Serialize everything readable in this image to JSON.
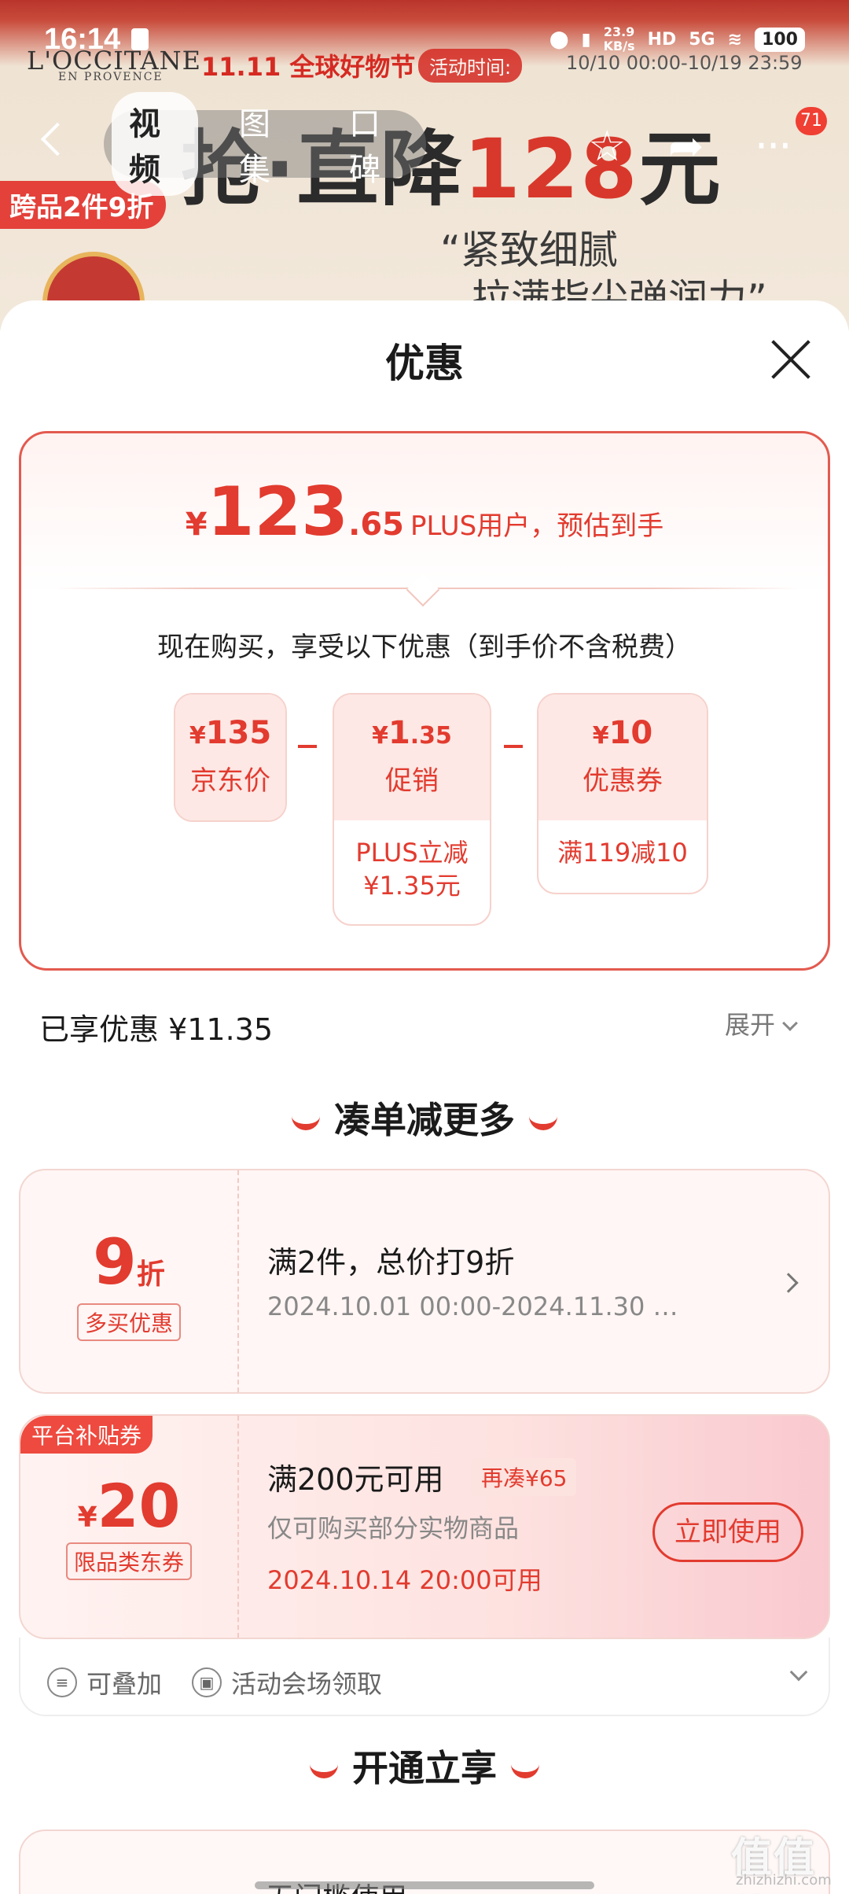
{
  "status_bar": {
    "time": "16:14",
    "net_speed_top": "23.9",
    "net_speed_bottom": "KB/s",
    "hd": "HD",
    "signal": "5G",
    "battery": "100"
  },
  "background": {
    "brand_logo": "L'OCCITANE",
    "brand_sub": "EN PROVENCE",
    "festival": "11.11 全球好物节",
    "activity_time_label": "活动时间:",
    "activity_time_range": "10/10 00:00-10/19 23:59",
    "banner_text_prefix": "抢·直降",
    "banner_number": "128",
    "banner_unit": "元",
    "slogan_line1": "“紧致细腻",
    "slogan_line2": "拉满指尖弹润力”",
    "cross_promo_tag": "跨品2件9折"
  },
  "nav": {
    "tabs": [
      "视频",
      "图集",
      "口碑"
    ],
    "active_tab": "视频",
    "more_badge": "71"
  },
  "sheet": {
    "title": "优惠",
    "estimate": {
      "yen": "¥",
      "int": "123",
      "dec": ".65",
      "label": "PLUS用户，预估到手"
    },
    "buy_hint": "现在购买，享受以下优惠（到手价不含税费）",
    "breakdown": [
      {
        "amount_yen": "¥",
        "amount_int": "135",
        "amount_dec": "",
        "name": "京东价",
        "detail": ""
      },
      {
        "amount_yen": "¥",
        "amount_int": "1",
        "amount_dec": ".35",
        "name": "促销",
        "detail": "PLUS立减\n¥1.35元"
      },
      {
        "amount_yen": "¥",
        "amount_int": "10",
        "amount_dec": "",
        "name": "优惠券",
        "detail": "满119减10"
      }
    ],
    "enjoyed": "已享优惠 ¥11.35",
    "expand": "展开",
    "section_more": "凑单减更多",
    "coupon1": {
      "big": "9",
      "big_unit": "折",
      "tag": "多买优惠",
      "title": "满2件，总价打9折",
      "sub": "2024.10.01 00:00-2024.11.30 …"
    },
    "coupon2": {
      "corner_label": "平台补贴券",
      "yen": "¥",
      "big": "20",
      "tag": "限品类东券",
      "title": "满200元可用",
      "again": "再凑¥65",
      "sub": "仅可购买部分实物商品",
      "time": "2024.10.14 20:00可用",
      "button": "立即使用",
      "feature1": "可叠加",
      "feature2": "活动会场领取"
    },
    "section_open": "开通立享",
    "peek_text": "无门槛使用"
  },
  "watermark": {
    "main": "值值值",
    "sub": "zhizhizhi.com"
  }
}
